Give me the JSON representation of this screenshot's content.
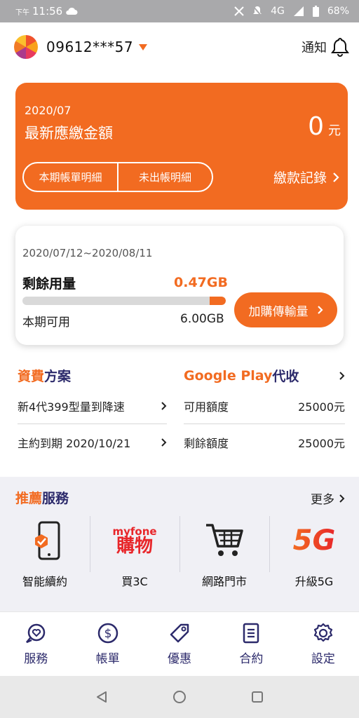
{
  "status_bar": {
    "ampm": "下午",
    "time": "11:56",
    "network": "4G",
    "battery": "68%"
  },
  "header": {
    "phone_number": "09612***57",
    "notify_label": "通知"
  },
  "bill": {
    "period": "2020/07",
    "title": "最新應繳金額",
    "amount": "0",
    "unit": "元",
    "btn_current": "本期帳單明細",
    "btn_unbilled": "未出帳明細",
    "pay_record": "繳款記錄"
  },
  "usage": {
    "period": "2020/07/12~2020/08/11",
    "remaining_label": "剩餘用量",
    "remaining_value": "0.47GB",
    "remaining_fraction": 0.078,
    "available_label": "本期可用",
    "available_value": "6.00GB",
    "buy_button": "加購傳輸量"
  },
  "plan": {
    "title_part1": "資費",
    "title_part2": "方案",
    "rows": [
      {
        "text": "新4代399型量到降速"
      },
      {
        "text": "主約到期 2020/10/21"
      }
    ]
  },
  "google_play": {
    "title_part1": "Google Play",
    "title_part2": "代收",
    "rows": [
      {
        "label": "可用額度",
        "value": "25000元"
      },
      {
        "label": "剩餘額度",
        "value": "25000元"
      }
    ]
  },
  "recommend": {
    "title_part1": "推薦",
    "title_part2": "服務",
    "more": "更多",
    "items": [
      {
        "label": "智能續約",
        "icon": "phone-renew-icon"
      },
      {
        "label": "買3C",
        "icon": "myfone-shop-logo",
        "logo_top": "myfone",
        "logo_bottom": "購物"
      },
      {
        "label": "網路門市",
        "icon": "shopping-cart-icon"
      },
      {
        "label": "升級5G",
        "icon": "5g-logo",
        "logo_text": "5G"
      }
    ]
  },
  "bottom_nav": [
    {
      "label": "服務",
      "icon": "heart-chat-icon"
    },
    {
      "label": "帳單",
      "icon": "dollar-circle-icon"
    },
    {
      "label": "優惠",
      "icon": "tag-icon"
    },
    {
      "label": "合約",
      "icon": "document-icon"
    },
    {
      "label": "設定",
      "icon": "gear-icon"
    }
  ],
  "colors": {
    "accent": "#f26b21",
    "navy": "#2c2a6b"
  }
}
